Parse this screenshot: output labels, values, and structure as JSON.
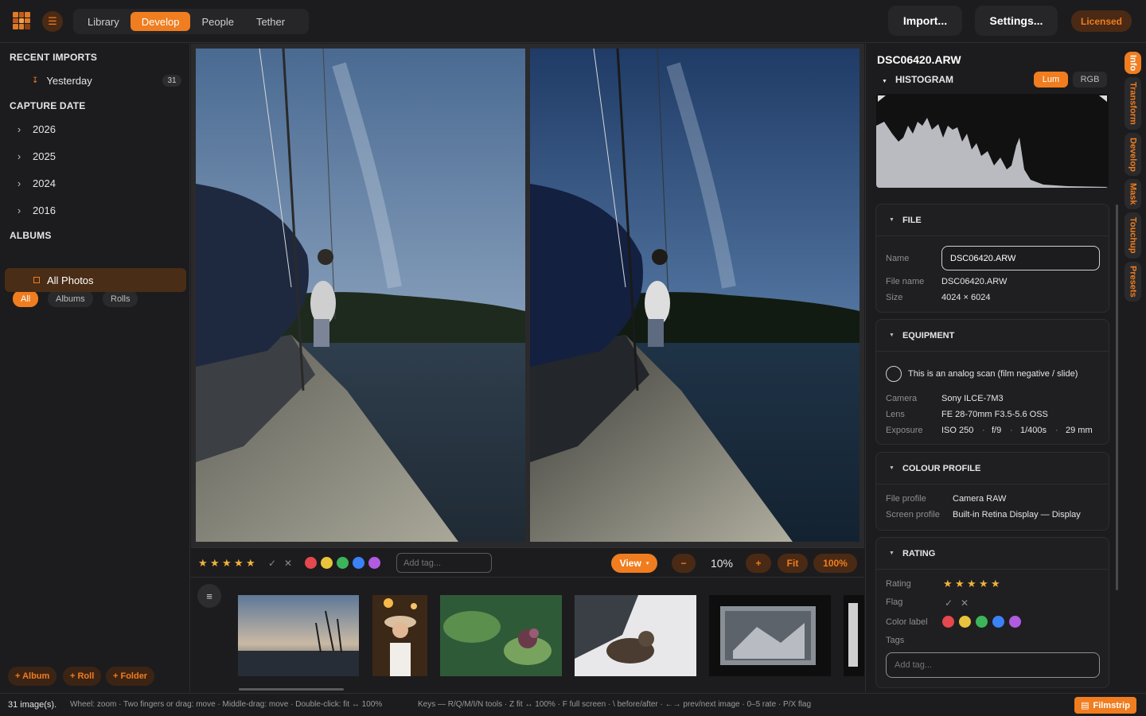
{
  "topbar": {
    "menu_icon": "hamburger-icon",
    "tabs": [
      "Library",
      "Develop",
      "People",
      "Tether"
    ],
    "active_tab": "Develop",
    "import_label": "Import...",
    "settings_label": "Settings...",
    "licensed_label": "Licensed"
  },
  "sidebar": {
    "recent_imports_title": "RECENT IMPORTS",
    "recent_imports": [
      {
        "label": "Yesterday",
        "count": "31"
      }
    ],
    "capture_date_title": "CAPTURE DATE",
    "years": [
      "2026",
      "2025",
      "2024",
      "2016"
    ],
    "albums_title": "ALBUMS",
    "album_filters": [
      "All",
      "Albums",
      "Rolls"
    ],
    "active_album_filter": "All",
    "album_items": [
      "All Photos"
    ],
    "add_album": "+ Album",
    "add_roll": "+ Roll",
    "add_folder": "+ Folder"
  },
  "toolbar": {
    "stars": [
      "★",
      "★",
      "★",
      "★",
      "★"
    ],
    "pick": "✓",
    "reject": "✕",
    "color_labels": [
      "#e5484d",
      "#e9c33b",
      "#3cb55a",
      "#3b82f6",
      "#b15be0"
    ],
    "tag_placeholder": "Add tag...",
    "view_label": "View",
    "view_icon": "▾",
    "zoom_out": "−",
    "zoom_level": "10%",
    "zoom_in": "+",
    "fit_label": "Fit",
    "full_label": "100%"
  },
  "right_panel": {
    "file_name_heading": "DSC06420.ARW",
    "histogram_title": "HISTOGRAM",
    "histogram_modes": [
      "Lum",
      "RGB"
    ],
    "active_histogram_mode": "Lum",
    "file": {
      "title": "FILE",
      "name_label": "Name",
      "name_value": "DSC06420.ARW",
      "filename_label": "File name",
      "filename_value": "DSC06420.ARW",
      "size_label": "Size",
      "size_value": "4024 × 6024"
    },
    "equipment": {
      "title": "EQUIPMENT",
      "analog_label": "This is an analog scan (film negative / slide)",
      "camera_label": "Camera",
      "camera_value": "Sony ILCE-7M3",
      "lens_label": "Lens",
      "lens_value": "FE 28-70mm F3.5-5.6 OSS",
      "exposure_label": "Exposure",
      "exposure_values": [
        "ISO 250",
        "f/9",
        "1/400s",
        "29 mm"
      ],
      "exposure_separator": "·"
    },
    "colour_profile": {
      "title": "COLOUR PROFILE",
      "file_profile_label": "File profile",
      "file_profile_value": "Camera RAW",
      "screen_profile_label": "Screen profile",
      "screen_profile_value": "Built-in Retina Display — Display"
    },
    "rating": {
      "title": "RATING",
      "rating_label": "Rating",
      "flag_label": "Flag",
      "color_label_label": "Color label",
      "tags_label": "Tags",
      "tag_placeholder": "Add tag..."
    }
  },
  "side_tabs": [
    "Info",
    "Transform",
    "Develop",
    "Mask",
    "Touchup",
    "Presets"
  ],
  "active_side_tab": "Info",
  "status": {
    "image_count": "31 image(s).",
    "mouse_hint": "Wheel: zoom · Two fingers or drag: move · Middle-drag: move · Double-click: fit ↔ 100%",
    "keys_hint": "Keys — R/Q/M/I/N tools · Z fit ↔ 100% · F full screen · \\ before/after · ←→ prev/next image · 0–5 rate · P/X flag",
    "filmstrip_label": "Filmstrip",
    "filmstrip_icon": "▤"
  },
  "colors": {
    "accent": "#f07d1f",
    "background": "#1c1c1e"
  }
}
